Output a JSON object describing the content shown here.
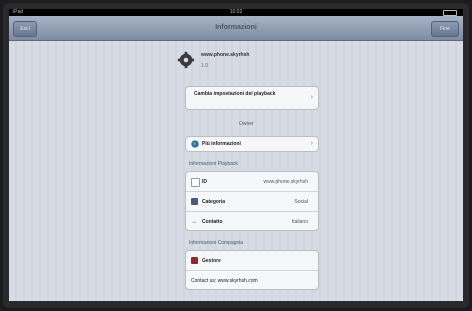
{
  "statusbar": {
    "carrier": "iPad",
    "time": "10:02"
  },
  "navbar": {
    "title": "Informazioni",
    "left_button": "Esci",
    "right_button": "Fine"
  },
  "profile": {
    "name": "www.phone.skyrhsh",
    "sub": "1.0"
  },
  "settings_card": {
    "label": "Cambia impostazioni del playback",
    "chevron": "›"
  },
  "owner_section": {
    "label": "Owner",
    "info_row_label": "Più informazioni",
    "chevron": "›"
  },
  "playback_section": {
    "label": "Informazioni Playback",
    "rows": [
      {
        "label": "ID",
        "value": "www.phone.skyrhsh",
        "icon": "id-icon"
      },
      {
        "label": "Categoria",
        "value": "Social",
        "icon": "category-icon"
      },
      {
        "label": "Contatto",
        "value": "Italiano",
        "icon": "arrow-icon"
      }
    ]
  },
  "company_section": {
    "label": "Informazioni Compagnia",
    "rows": [
      {
        "label": "Gestore",
        "icon": "company-logo-icon"
      },
      {
        "label": "Contact us: www.skyrhsh.com"
      }
    ]
  },
  "colors": {
    "navbar": "#7d8ca3",
    "background": "#d7dbe3",
    "card": "#f6f7f9",
    "globe_blue": "#2a6bb8"
  }
}
